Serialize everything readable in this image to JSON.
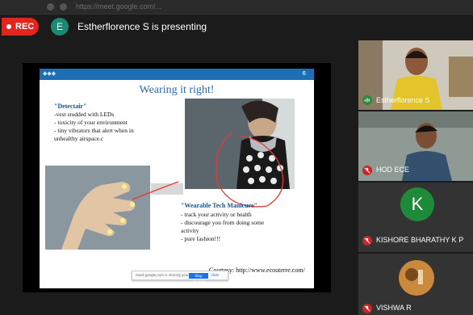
{
  "browser": {
    "url": "https://meet.google.com/..."
  },
  "recording": {
    "label": "REC"
  },
  "presenter": {
    "avatar_letter": "E",
    "text": "Estherflorence S is presenting"
  },
  "slide": {
    "page_number": "6",
    "title": "Wearing it right!",
    "detectair": {
      "heading": "\"Detectair\"",
      "lines": [
        "-vest studded with LEDs",
        "- toxicity of your environment",
        "- tiny vibrators that alert when in",
        "unhealthy airspace.c"
      ]
    },
    "wearable": {
      "heading": "\"Wearable Tech Manicure\"",
      "lines": [
        "- track your activity or health",
        "- discourage you from doing some",
        "activity",
        "- pure fashion!!!"
      ]
    },
    "courtesy": "Courtesy: http://www.ecouterre.com/"
  },
  "share_toast": {
    "message": "meet.google.com is sharing your screen.",
    "stop_label": "Stop sharing",
    "hide_label": "Hide"
  },
  "participants": [
    {
      "name": "Estherflorence S",
      "mic": "on"
    },
    {
      "name": "HOD ECE",
      "mic": "off"
    },
    {
      "name": "KISHORE BHARATHY K P",
      "mic": "off",
      "avatar_letter": "K"
    },
    {
      "name": "VISHWA R",
      "mic": "off"
    }
  ],
  "colors": {
    "rec": "#e0261f",
    "presenter_avatar": "#1c8a72",
    "slide_bar": "#1d6fb5",
    "mic_off": "#c62828",
    "avatar_k": "#1e8b3a"
  }
}
